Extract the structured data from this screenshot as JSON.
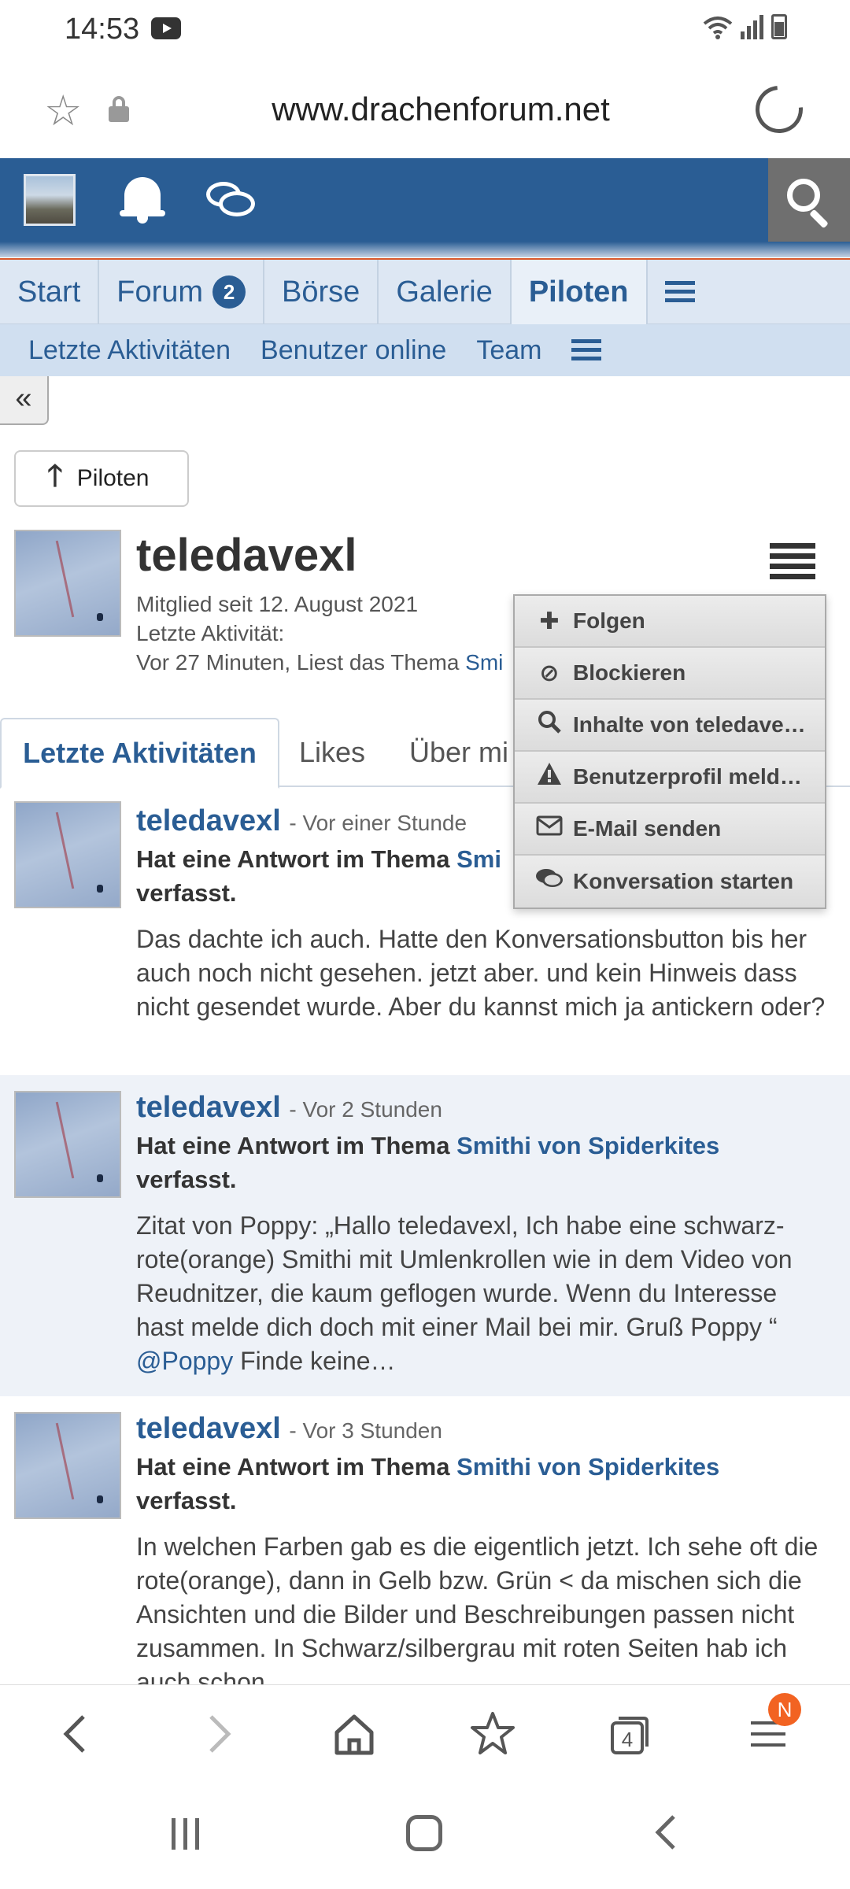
{
  "status_bar": {
    "time": "14:53",
    "icons": [
      "youtube-icon",
      "wifi-icon",
      "signal-icon",
      "battery-icon"
    ]
  },
  "browser": {
    "url": "www.drachenforum.net",
    "icons": [
      "star-icon",
      "lock-icon",
      "reload-icon"
    ]
  },
  "header": {
    "icons": [
      "site-logo",
      "bell-icon",
      "chat-icon",
      "search-icon"
    ],
    "colors": {
      "brand": "#2a5d94",
      "search_bg": "#6f6f6f"
    }
  },
  "nav": {
    "tabs": [
      {
        "label": "Start"
      },
      {
        "label": "Forum",
        "badge": "2"
      },
      {
        "label": "Börse"
      },
      {
        "label": "Galerie"
      },
      {
        "label": "Piloten",
        "selected": true
      }
    ]
  },
  "subnav": {
    "items": [
      "Letzte Aktivitäten",
      "Benutzer online",
      "Team"
    ]
  },
  "collapse_label": "«",
  "back_button": {
    "label": "Piloten"
  },
  "profile": {
    "name": "teledavexl",
    "member_since": "Mitglied seit 12. August 2021",
    "last_activity_label": "Letzte Aktivität:",
    "last_activity_text": "Vor 27 Minuten, Liest das Thema ",
    "last_activity_link": "Smi"
  },
  "profile_tabs": [
    "Letzte Aktivitäten",
    "Likes",
    "Über mi"
  ],
  "dropdown": {
    "items": [
      {
        "icon": "plus-icon",
        "label": "Folgen"
      },
      {
        "icon": "block-icon",
        "label": "Blockieren"
      },
      {
        "icon": "search-icon",
        "label": "Inhalte von teledave…"
      },
      {
        "icon": "warning-icon",
        "label": "Benutzerprofil meld…"
      },
      {
        "icon": "mail-icon",
        "label": "E-Mail senden"
      },
      {
        "icon": "comments-icon",
        "label": "Konversation starten"
      }
    ]
  },
  "feed": [
    {
      "user": "teledavexl",
      "time": "- Vor einer Stunde",
      "action_prefix": "Hat eine Antwort im Thema ",
      "action_link": "Smi",
      "action_suffix": "verfasst.",
      "snippet": "Das dachte ich auch. Hatte den Konversationsbutton bis her auch noch nicht gesehen. jetzt aber. und kein Hinweis dass nicht gesendet wurde. Aber du kannst mich ja antickern oder?"
    },
    {
      "user": "teledavexl",
      "time": "- Vor 2 Stunden",
      "action_prefix": "Hat eine Antwort im Thema ",
      "action_link": "Smithi von Spiderkites",
      "action_suffix": "verfasst.",
      "snippet": "Zitat von Poppy: „Hallo teledavexl, Ich habe eine schwarz-rote(orange) Smithi mit Umlenkrollen wie in dem Video von Reudnitzer, die kaum geflogen wurde. Wenn du Interesse hast melde dich doch mit einer Mail bei mir. Gruß Poppy “ ",
      "snippet_mention": "@Poppy",
      "snippet_end": " Finde keine…"
    },
    {
      "user": "teledavexl",
      "time": "- Vor 3 Stunden",
      "action_prefix": "Hat eine Antwort im Thema ",
      "action_link": "Smithi von Spiderkites",
      "action_suffix": "verfasst.",
      "snippet": "In welchen Farben gab es die eigentlich jetzt. Ich sehe oft die rote(orange), dann in Gelb bzw. Grün < da mischen sich die Ansichten und die Bilder und Beschreibungen passen nicht zusammen. In Schwarz/silbergrau mit roten Seiten hab ich auch schon"
    }
  ],
  "bottom_bar": {
    "tabs_count": "4",
    "notification_badge": "N",
    "icons": [
      "back-icon",
      "forward-icon",
      "home-icon",
      "bookmarks-icon",
      "tabs-icon",
      "menu-icon"
    ]
  }
}
